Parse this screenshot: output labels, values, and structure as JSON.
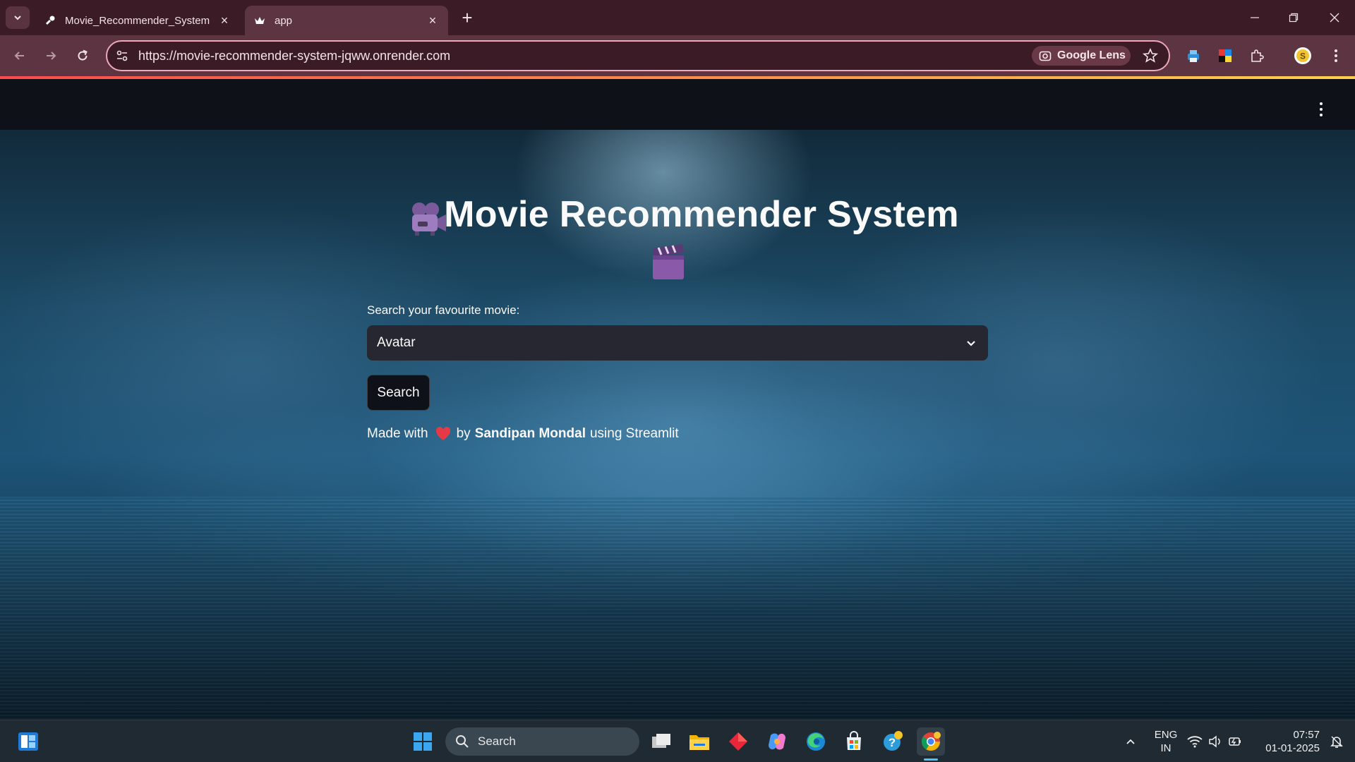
{
  "browser": {
    "tabs": [
      {
        "title": "Movie_Recommender_System",
        "icon": "link-icon",
        "active": false
      },
      {
        "title": "app",
        "icon": "streamlit-crown-icon",
        "active": true
      }
    ],
    "url": "https://movie-recommender-system-jqww.onrender.com",
    "lens_label": "Google Lens"
  },
  "app": {
    "title": "Movie Recommender System",
    "select_label": "Search your favourite movie:",
    "selected_movie": "Avatar",
    "search_button": "Search",
    "footer": {
      "made_with": "Made with",
      "by": "by",
      "author": "Sandipan Mondal",
      "using": "using Streamlit"
    }
  },
  "taskbar": {
    "search_placeholder": "Search",
    "language_line1": "ENG",
    "language_line2": "IN",
    "time": "07:57",
    "date": "01-01-2025"
  },
  "colors": {
    "browser_frame": "#3a1b26",
    "toolbar": "#5c3442",
    "app_bg": "#0e1117",
    "select_bg": "#262730",
    "accent_red": "#ff4b4b"
  }
}
